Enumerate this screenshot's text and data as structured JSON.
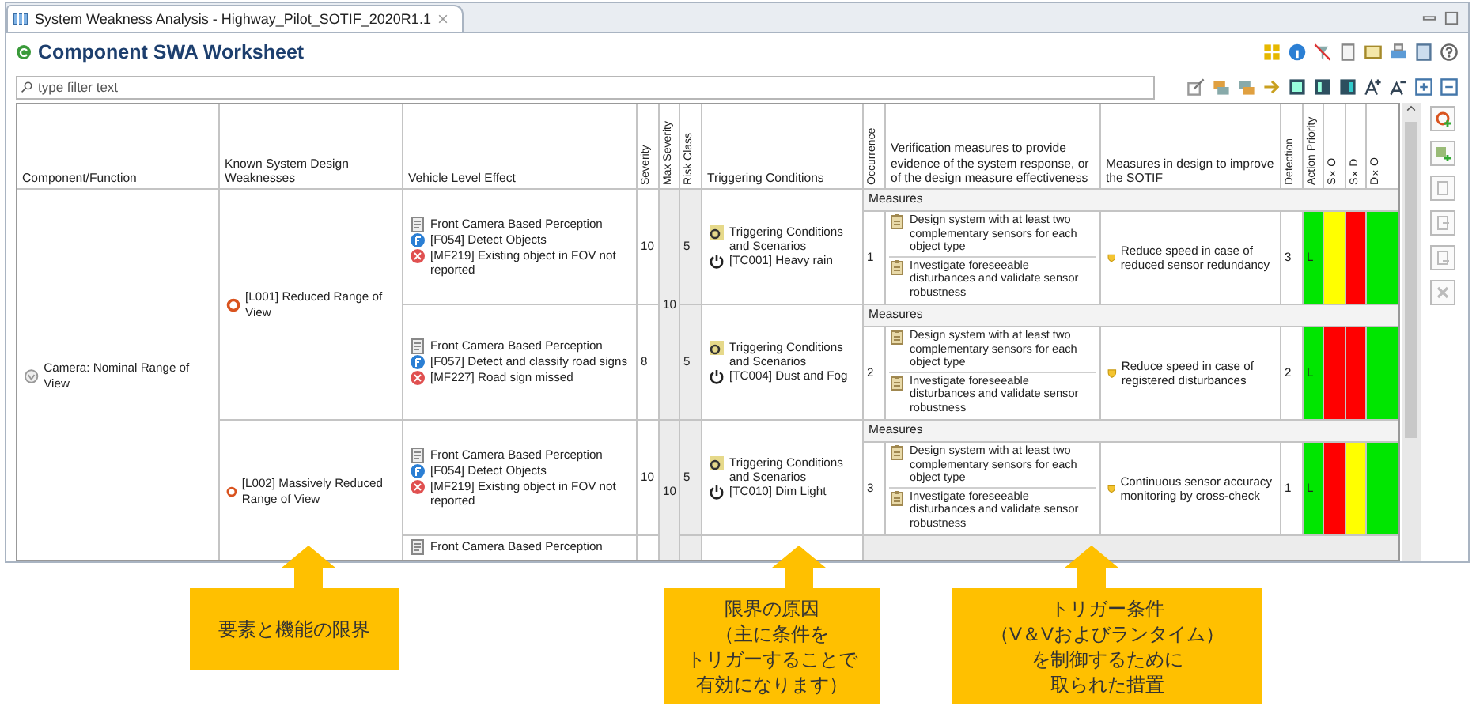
{
  "tab": {
    "title": "System Weakness Analysis - Highway_Pilot_SOTIF_2020R1.1",
    "selected": true
  },
  "editor": {
    "title": "Component SWA Worksheet"
  },
  "filter": {
    "placeholder": "type filter text"
  },
  "table": {
    "columns": [
      {
        "label": "Component/Function",
        "kind": "horizontal"
      },
      {
        "label": "Known System Design Weaknesses",
        "kind": "horizontal"
      },
      {
        "label": "Vehicle Level Effect",
        "kind": "horizontal"
      },
      {
        "label": "Severity",
        "kind": "vertical"
      },
      {
        "label": "Max Severity",
        "kind": "vertical"
      },
      {
        "label": "Risk Class",
        "kind": "vertical"
      },
      {
        "label": "Triggering Conditions",
        "kind": "horizontal"
      },
      {
        "label": "Occurrence",
        "kind": "vertical"
      },
      {
        "label": "Verification measures to provide evidence of the system response, or of the design measure effectiveness",
        "kind": "horizontal"
      },
      {
        "label": "Measures in design to improve the SOTIF",
        "kind": "horizontal"
      },
      {
        "label": "Detection",
        "kind": "vertical"
      },
      {
        "label": "Action Priority",
        "kind": "vertical"
      },
      {
        "label": "S×O",
        "kind": "vertical"
      },
      {
        "label": "S×D",
        "kind": "vertical"
      },
      {
        "label": "D×O",
        "kind": "vertical"
      }
    ],
    "component": "Camera: Nominal Range of View",
    "weaknesses": [
      {
        "label": "[L001] Reduced Range of View",
        "max_severity": "10",
        "effects": [
          {
            "function_group": "Front Camera Based Perception",
            "function": "[F054] Detect Objects",
            "malfunction": "[MF219] Existing object in FOV not reported",
            "severity": "10",
            "risk_class": "5",
            "trigger_group": "Triggering Conditions and Scenarios",
            "trigger": "[TC001] Heavy rain",
            "measures_label": "Measures",
            "occurrence": "1",
            "verifications": [
              "Design system with at least two complementary sensors for each object type",
              "Investigate foreseeable disturbances and validate sensor robustness"
            ],
            "design_measure": "Reduce speed in case of reduced sensor redundancy",
            "detection": "3",
            "ratings": [
              {
                "text": "L",
                "color": "#00e600"
              },
              {
                "color": "#ffff00"
              },
              {
                "color": "#ff0000"
              },
              {
                "color": "#00e600"
              }
            ]
          },
          {
            "function_group": "Front Camera Based Perception",
            "function": "[F057] Detect and classify road signs",
            "malfunction": "[MF227] Road sign missed",
            "severity": "8",
            "risk_class": "5",
            "trigger_group": "Triggering Conditions and Scenarios",
            "trigger": "[TC004] Dust and Fog",
            "measures_label": "Measures",
            "occurrence": "2",
            "verifications": [
              "Design system with at least two complementary sensors for each object type",
              "Investigate foreseeable disturbances and validate sensor robustness"
            ],
            "design_measure": "Reduce speed in case of registered disturbances",
            "detection": "2",
            "ratings": [
              {
                "text": "L",
                "color": "#00e600"
              },
              {
                "color": "#ff0000"
              },
              {
                "color": "#ff0000"
              },
              {
                "color": "#00e600"
              }
            ]
          }
        ]
      },
      {
        "label": "[L002] Massively Reduced Range of View",
        "max_severity": "10",
        "effects": [
          {
            "function_group": "Front Camera Based Perception",
            "function": "[F054] Detect Objects",
            "malfunction": "[MF219] Existing object in FOV not reported",
            "severity": "10",
            "risk_class": "5",
            "trigger_group": "Triggering Conditions and Scenarios",
            "trigger": "[TC010] Dim Light",
            "measures_label": "Measures",
            "occurrence": "3",
            "verifications": [
              "Design system with at least two complementary sensors for each object type",
              "Investigate foreseeable disturbances and validate sensor robustness"
            ],
            "design_measure": "Continuous sensor accuracy monitoring by cross-check",
            "detection": "1",
            "ratings": [
              {
                "text": "L",
                "color": "#00e600"
              },
              {
                "color": "#ff0000"
              },
              {
                "color": "#ffff00"
              },
              {
                "color": "#00e600"
              }
            ]
          },
          {
            "function_group": "Front Camera Based Perception"
          }
        ]
      }
    ]
  },
  "callouts": [
    {
      "lines": [
        "要素と機能の限界"
      ]
    },
    {
      "lines": [
        "限界の原因",
        "（主に条件を",
        "トリガーすることで",
        "有効になります）"
      ]
    },
    {
      "lines": [
        "トリガー条件",
        "（V＆Vおよびランタイム）",
        "を制御するために",
        "取られた措置"
      ]
    }
  ]
}
